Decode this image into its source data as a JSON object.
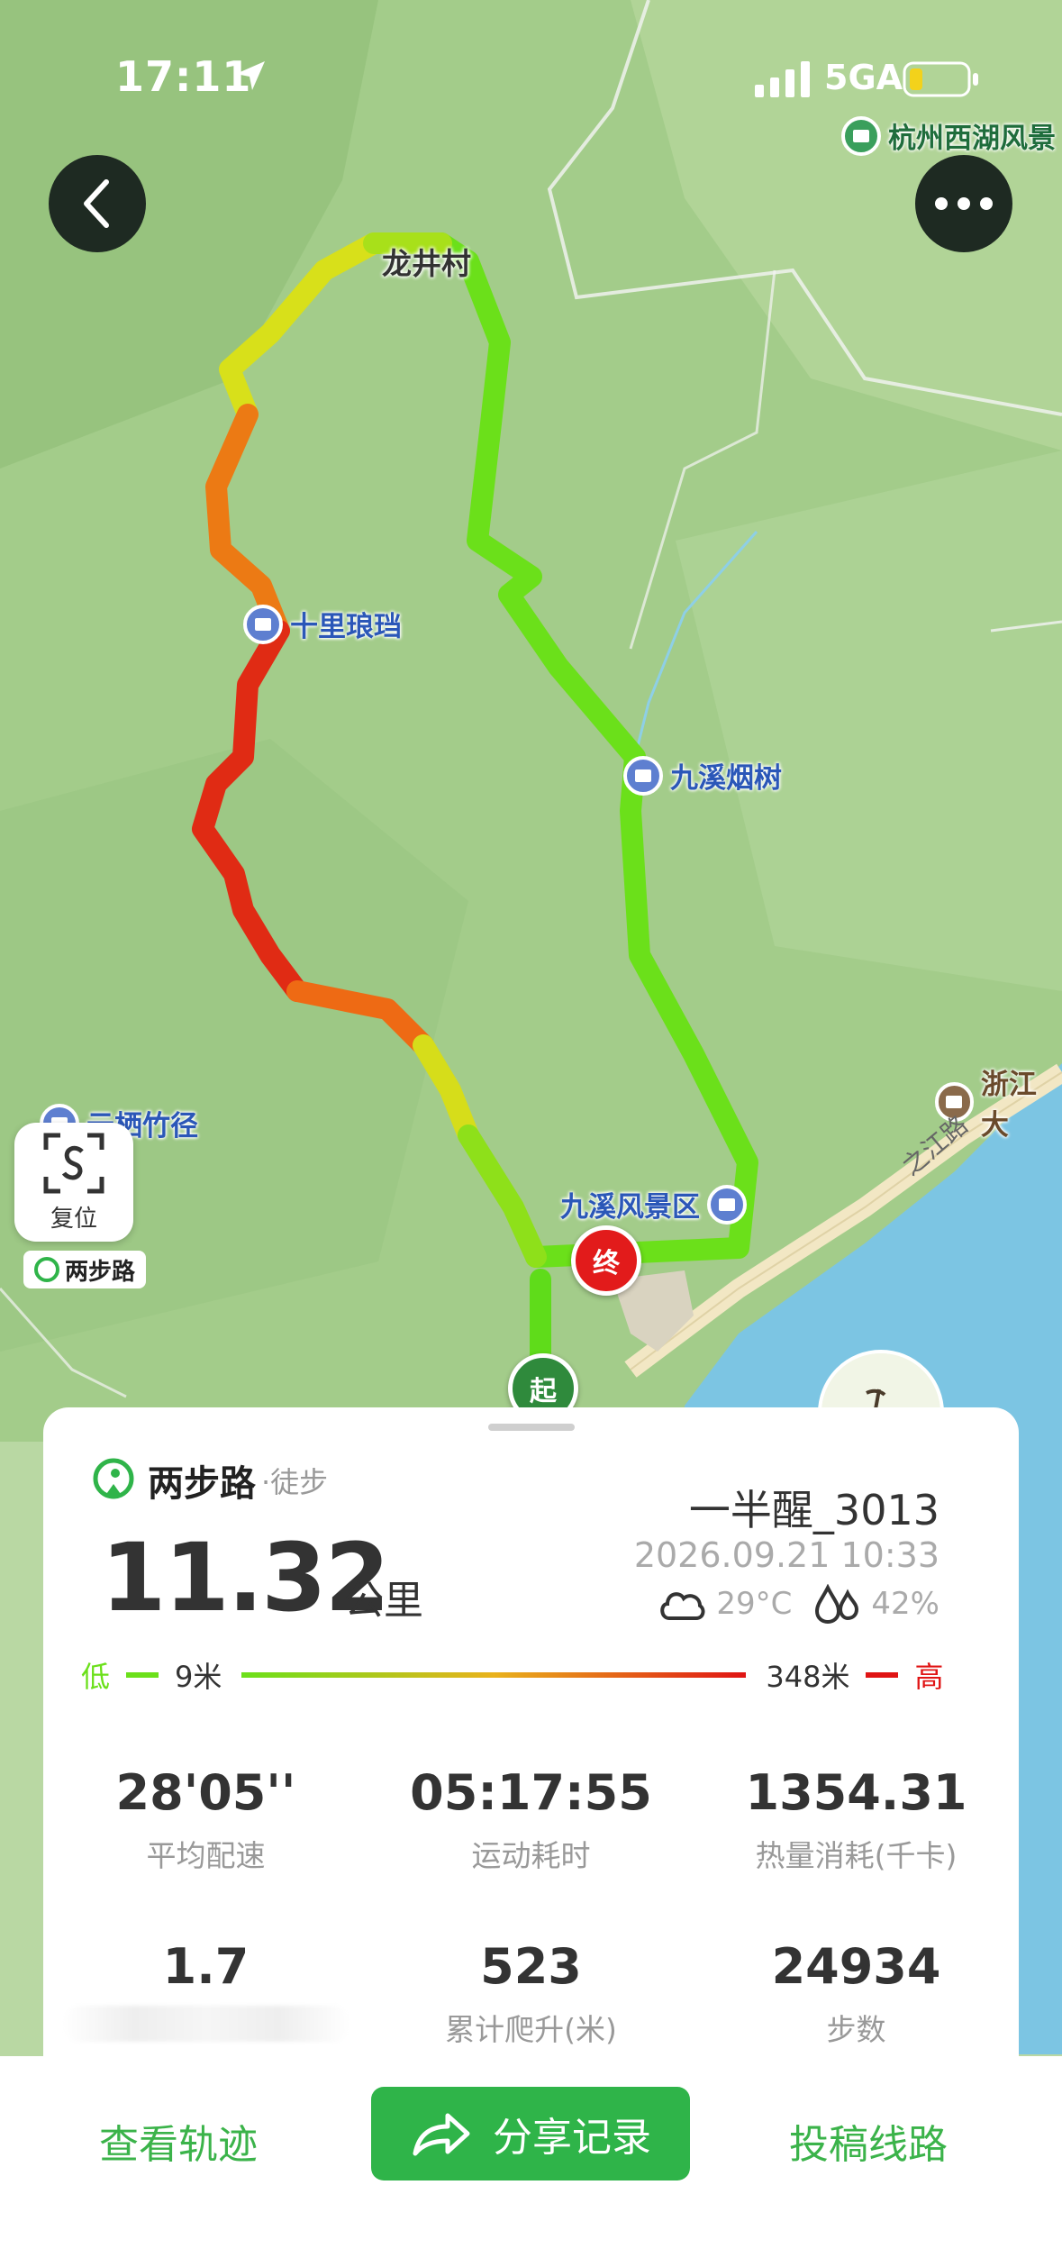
{
  "status_bar": {
    "time": "17:11",
    "network": "5GA"
  },
  "map": {
    "top_label": "杭州西湖风景",
    "pois": {
      "shili": "十里琅珰",
      "jiuxi_yanshu": "九溪烟树",
      "jiuxi_scenic": "九溪风景区",
      "yunqi": "云栖竹径",
      "zhejiang": "浙江大"
    },
    "village": "龙井村",
    "road": "之江路",
    "end_marker": "终",
    "start_marker": "起",
    "reset_label": "复位",
    "brand_tag": "两步路"
  },
  "summary": {
    "app_name": "两步路",
    "activity": "·徒步",
    "distance": "11.32",
    "distance_unit": "公里",
    "username": "一半醒_3013",
    "datetime": "2026.09.21 10:33",
    "temperature": "29°C",
    "humidity": "42%",
    "elevation_low_label": "低",
    "elevation_min": "9米",
    "elevation_max": "348米",
    "elevation_high_label": "高",
    "stats": [
      {
        "value": "28'05''",
        "label": "平均配速"
      },
      {
        "value": "05:17:55",
        "label": "运动耗时"
      },
      {
        "value": "1354.31",
        "label": "热量消耗(千卡)"
      },
      {
        "value": "1.7",
        "label": ""
      },
      {
        "value": "523",
        "label": "累计爬升(米)"
      },
      {
        "value": "24934",
        "label": "步数"
      }
    ]
  },
  "bottom_bar": {
    "view_track": "查看轨迹",
    "share": "分享记录",
    "submit_route": "投稿线路"
  },
  "colors": {
    "accent": "#2fb449",
    "track_low": "#6be01a",
    "track_high": "#e01414",
    "water": "#7cc5e3"
  }
}
